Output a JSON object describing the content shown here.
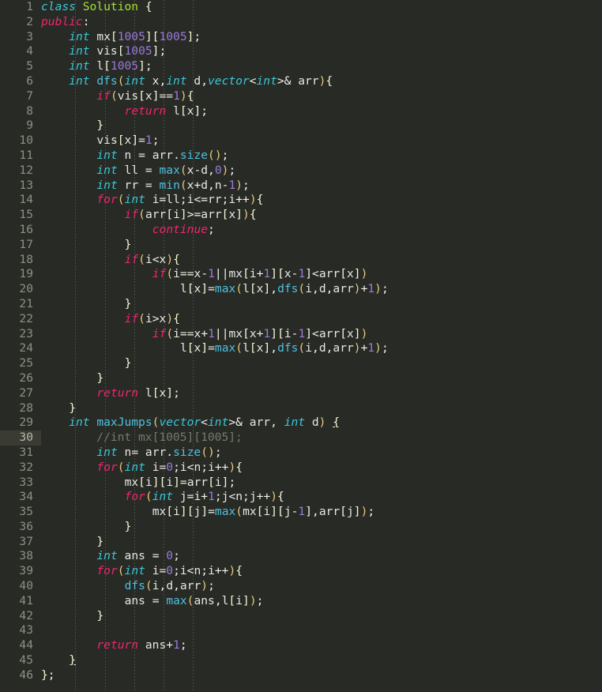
{
  "editor": {
    "language": "cpp",
    "theme": "monokai-dark",
    "background_color": "#282a26",
    "active_line": 30,
    "first_line": 1,
    "last_line": 46,
    "total_lines": 46,
    "line_number_color": "#8d9181",
    "active_line_gutter_color": "#3a3c33",
    "colors": {
      "keyword": "#f0256f",
      "type": "#38c8d8",
      "class_name": "#a6e22e",
      "function": "#4fc1e0",
      "number": "#9d79dc",
      "comment": "#757a6a",
      "plain": "#e8e8e3",
      "bracket": "#f8f8d8",
      "paren": "#e8c97a"
    },
    "lines": [
      {
        "n": 1,
        "text": "class Solution {"
      },
      {
        "n": 2,
        "text": "public:"
      },
      {
        "n": 3,
        "text": "    int mx[1005][1005];"
      },
      {
        "n": 4,
        "text": "    int vis[1005];"
      },
      {
        "n": 5,
        "text": "    int l[1005];"
      },
      {
        "n": 6,
        "text": "    int dfs(int x,int d,vector<int>& arr){"
      },
      {
        "n": 7,
        "text": "        if(vis[x]==1){"
      },
      {
        "n": 8,
        "text": "            return l[x];"
      },
      {
        "n": 9,
        "text": "        }"
      },
      {
        "n": 10,
        "text": "        vis[x]=1;"
      },
      {
        "n": 11,
        "text": "        int n = arr.size();"
      },
      {
        "n": 12,
        "text": "        int ll = max(x-d,0);"
      },
      {
        "n": 13,
        "text": "        int rr = min(x+d,n-1);"
      },
      {
        "n": 14,
        "text": "        for(int i=ll;i<=rr;i++){"
      },
      {
        "n": 15,
        "text": "            if(arr[i]>=arr[x]){"
      },
      {
        "n": 16,
        "text": "                continue;"
      },
      {
        "n": 17,
        "text": "            }"
      },
      {
        "n": 18,
        "text": "            if(i<x){"
      },
      {
        "n": 19,
        "text": "                if(i==x-1||mx[i+1][x-1]<arr[x])"
      },
      {
        "n": 20,
        "text": "                    l[x]=max(l[x],dfs(i,d,arr)+1);"
      },
      {
        "n": 21,
        "text": "            }"
      },
      {
        "n": 22,
        "text": "            if(i>x){"
      },
      {
        "n": 23,
        "text": "                if(i==x+1||mx[x+1][i-1]<arr[x])"
      },
      {
        "n": 24,
        "text": "                    l[x]=max(l[x],dfs(i,d,arr)+1);"
      },
      {
        "n": 25,
        "text": "            }"
      },
      {
        "n": 26,
        "text": "        }"
      },
      {
        "n": 27,
        "text": "        return l[x];"
      },
      {
        "n": 28,
        "text": "    }"
      },
      {
        "n": 29,
        "text": "    int maxJumps(vector<int>& arr, int d) {"
      },
      {
        "n": 30,
        "text": "        //int mx[1005][1005];"
      },
      {
        "n": 31,
        "text": "        int n= arr.size();"
      },
      {
        "n": 32,
        "text": "        for(int i=0;i<n;i++){"
      },
      {
        "n": 33,
        "text": "            mx[i][i]=arr[i];"
      },
      {
        "n": 34,
        "text": "            for(int j=i+1;j<n;j++){"
      },
      {
        "n": 35,
        "text": "                mx[i][j]=max(mx[i][j-1],arr[j]);"
      },
      {
        "n": 36,
        "text": "            }"
      },
      {
        "n": 37,
        "text": "        }"
      },
      {
        "n": 38,
        "text": "        int ans = 0;"
      },
      {
        "n": 39,
        "text": "        for(int i=0;i<n;i++){"
      },
      {
        "n": 40,
        "text": "            dfs(i,d,arr);"
      },
      {
        "n": 41,
        "text": "            ans = max(ans,l[i]);"
      },
      {
        "n": 42,
        "text": "        }"
      },
      {
        "n": 43,
        "text": ""
      },
      {
        "n": 44,
        "text": "        return ans+1;"
      },
      {
        "n": 45,
        "text": "    }"
      },
      {
        "n": 46,
        "text": "};"
      }
    ],
    "bracket_match": {
      "open_line": 29,
      "close_line": 45,
      "open_char": "{",
      "close_char": "}"
    },
    "indent_guide_columns": [
      4,
      8,
      12,
      16,
      20
    ]
  }
}
